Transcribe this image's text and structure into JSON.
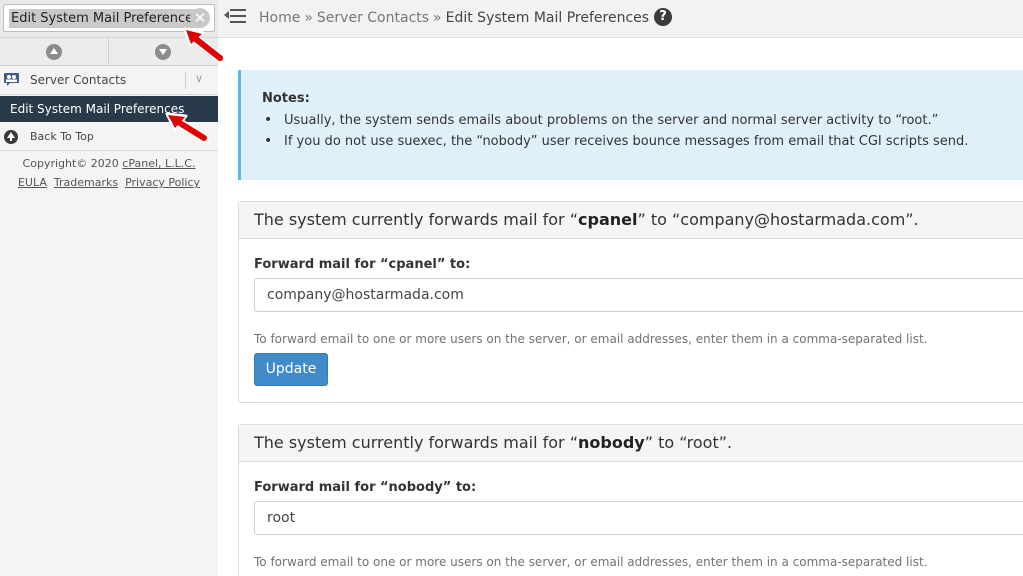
{
  "sidebar": {
    "search_value": "Edit System Mail Preferences",
    "group_label": "Server Contacts",
    "active_item": "Edit System Mail Preferences",
    "back_to_top": "Back To Top",
    "footer": {
      "copyright_prefix": "Copyright© 2020 ",
      "copyright_link": "cPanel, L.L.C.",
      "links": [
        "EULA",
        "Trademarks",
        "Privacy Policy"
      ]
    }
  },
  "header": {
    "breadcrumb": [
      "Home",
      "Server Contacts",
      "Edit System Mail Preferences"
    ],
    "separator": "»",
    "help": "?"
  },
  "notes": {
    "title": "Notes:",
    "items": [
      "Usually, the system sends emails about problems on the server and normal server activity to “root.”",
      "If you do not use suexec, the “nobody” user receives bounce messages from email that CGI scripts send."
    ]
  },
  "panels": [
    {
      "title_prefix": "The system currently forwards mail for “",
      "user": "cpanel",
      "title_suffix": "” to “company@hostarmada.com”.",
      "field_label": "Forward mail for “cpanel” to:",
      "field_value": "company@hostarmada.com",
      "help_text": "To forward email to one or more users on the server, or email addresses, enter them in a comma-separated list.",
      "button_label": "Update"
    },
    {
      "title_prefix": "The system currently forwards mail for “",
      "user": "nobody",
      "title_suffix": "” to “root”.",
      "field_label": "Forward mail for “nobody” to:",
      "field_value": "root",
      "help_text": "To forward email to one or more users on the server, or email addresses, enter them in a comma-separated list."
    }
  ],
  "colors": {
    "sidebar_active_bg": "#293a4a",
    "notes_bg": "#dff0fb",
    "notes_border": "#5bbbe6",
    "button_primary": "#428bca",
    "annotation_arrow": "#e00000"
  },
  "icons": {
    "clear": "close-icon",
    "scroll_up": "chevron-up-circle-icon",
    "scroll_down": "chevron-down-circle-icon",
    "group": "contacts-icon",
    "back_to_top": "arrow-up-circle-icon",
    "menu": "menu-collapse-icon",
    "help": "help-icon"
  }
}
